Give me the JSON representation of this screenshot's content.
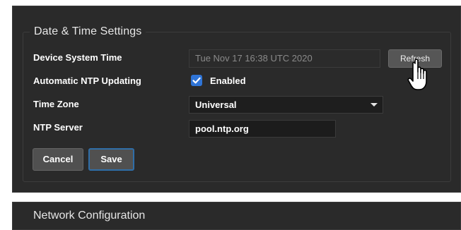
{
  "section": {
    "title": "Date & Time Settings"
  },
  "fields": {
    "device_time": {
      "label": "Device System Time",
      "value": "Tue Nov 17 16:38 UTC 2020",
      "refresh_label": "Refresh"
    },
    "ntp_updating": {
      "label": "Automatic NTP Updating",
      "checked": true,
      "checkbox_label": "Enabled"
    },
    "time_zone": {
      "label": "Time Zone",
      "selected": "Universal"
    },
    "ntp_server": {
      "label": "NTP Server",
      "value": "pool.ntp.org"
    }
  },
  "buttons": {
    "cancel_label": "Cancel",
    "save_label": "Save"
  },
  "next_section": {
    "title": "Network Configuration"
  },
  "colors": {
    "accent": "#2f74d6",
    "panel_bg": "#2a2a2a",
    "focus_border": "#2f6ea8"
  },
  "icons": {
    "checkbox": "check-icon",
    "dropdown": "chevron-down-icon",
    "cursor": "hand-pointer-icon"
  }
}
